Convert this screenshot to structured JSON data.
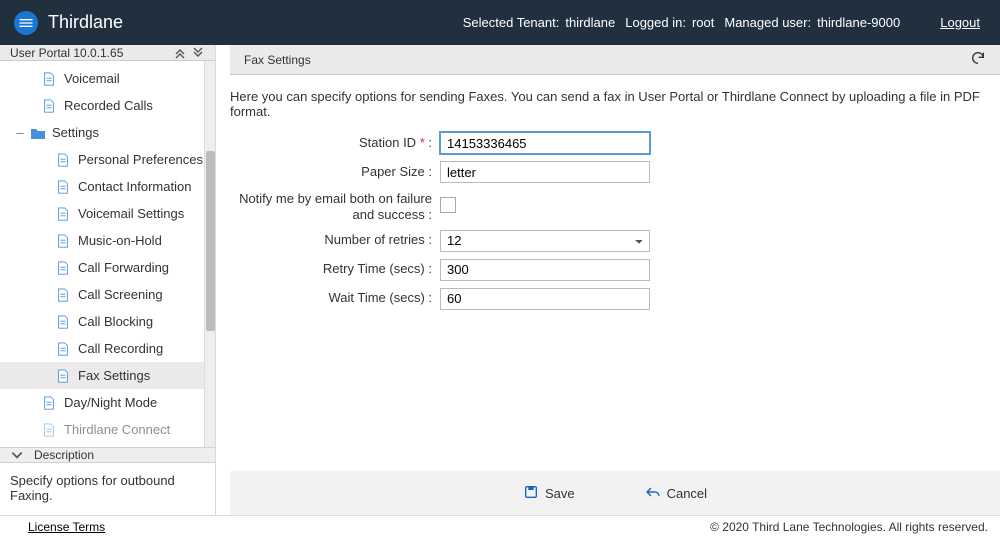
{
  "header": {
    "brand": "Thirdlane",
    "selected_tenant_label": "Selected Tenant:",
    "selected_tenant_value": "thirdlane",
    "logged_in_label": "Logged in:",
    "logged_in_value": "root",
    "managed_user_label": "Managed user:",
    "managed_user_value": "thirdlane-9000",
    "logout": "Logout"
  },
  "sidebar": {
    "title": "User Portal 10.0.1.65",
    "items_top": [
      {
        "label": "Voicemail"
      },
      {
        "label": "Recorded Calls"
      }
    ],
    "settings_label": "Settings",
    "settings_children": [
      {
        "label": "Personal Preferences"
      },
      {
        "label": "Contact Information"
      },
      {
        "label": "Voicemail Settings"
      },
      {
        "label": "Music-on-Hold"
      },
      {
        "label": "Call Forwarding"
      },
      {
        "label": "Call Screening"
      },
      {
        "label": "Call Blocking"
      },
      {
        "label": "Call Recording"
      },
      {
        "label": "Fax Settings",
        "selected": true
      }
    ],
    "items_bottom": [
      {
        "label": "Day/Night Mode"
      },
      {
        "label": "Thirdlane Connect"
      }
    ],
    "description_header": "Description",
    "description_body": "Specify options for outbound Faxing."
  },
  "content": {
    "title": "Fax Settings",
    "intro": "Here you can specify options for sending Faxes. You can send a fax in User Portal or Thirdlane Connect by uploading a file in PDF format.",
    "form": {
      "station_id": {
        "label": "Station ID",
        "required_mark": "*",
        "value": "14153336465"
      },
      "paper_size": {
        "label": "Paper Size :",
        "value": "letter"
      },
      "notify": {
        "label": "Notify me by email both on failure and success :"
      },
      "retries": {
        "label": "Number of retries :",
        "value": "12"
      },
      "retry_time": {
        "label": "Retry Time (secs) :",
        "value": "300"
      },
      "wait_time": {
        "label": "Wait Time (secs) :",
        "value": "60"
      }
    },
    "actions": {
      "save": "Save",
      "cancel": "Cancel"
    }
  },
  "footer": {
    "license": "License Terms",
    "copyright": "© 2020 Third Lane Technologies. All rights reserved."
  }
}
